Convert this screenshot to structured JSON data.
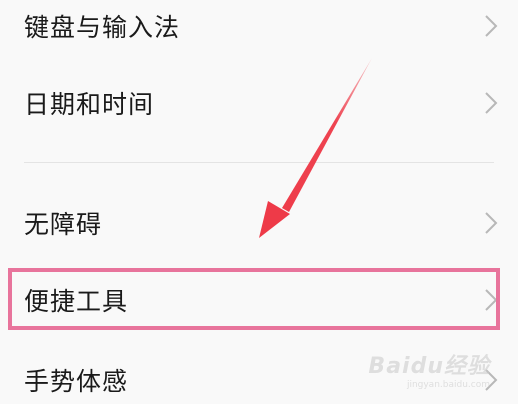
{
  "settings": {
    "items": [
      {
        "label": "键盘与输入法",
        "icon": "chevron-right-icon"
      },
      {
        "label": "日期和时间",
        "icon": "chevron-right-icon"
      },
      {
        "label": "无障碍",
        "icon": "chevron-right-icon"
      },
      {
        "label": "便捷工具",
        "icon": "chevron-right-icon"
      },
      {
        "label": "手势体感",
        "icon": "chevron-right-icon"
      }
    ]
  },
  "annotation": {
    "highlight_color": "#e8749c",
    "arrow_color": "#ee3a48"
  },
  "watermark": {
    "main": "Baidu经验",
    "sub": "jingyan.baidu.com"
  }
}
